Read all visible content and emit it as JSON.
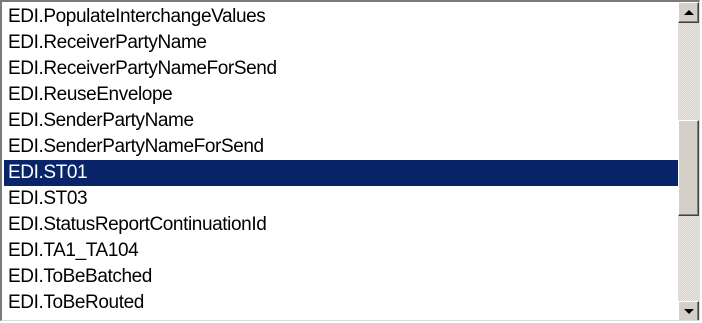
{
  "listbox": {
    "items": [
      {
        "label": "EDI.PopulateInterchangeValues",
        "selected": false
      },
      {
        "label": "EDI.ReceiverPartyName",
        "selected": false
      },
      {
        "label": "EDI.ReceiverPartyNameForSend",
        "selected": false
      },
      {
        "label": "EDI.ReuseEnvelope",
        "selected": false
      },
      {
        "label": "EDI.SenderPartyName",
        "selected": false
      },
      {
        "label": "EDI.SenderPartyNameForSend",
        "selected": false
      },
      {
        "label": "EDI.ST01",
        "selected": true
      },
      {
        "label": "EDI.ST03",
        "selected": false
      },
      {
        "label": "EDI.StatusReportContinuationId",
        "selected": false
      },
      {
        "label": "EDI.TA1_TA104",
        "selected": false
      },
      {
        "label": "EDI.ToBeBatched",
        "selected": false
      },
      {
        "label": "EDI.ToBeRouted",
        "selected": false
      }
    ]
  },
  "scrollbar": {
    "up_icon": "arrow-up-icon",
    "down_icon": "arrow-down-icon"
  },
  "colors": {
    "selection_bg": "#0a246a",
    "selection_fg": "#ffffff"
  }
}
